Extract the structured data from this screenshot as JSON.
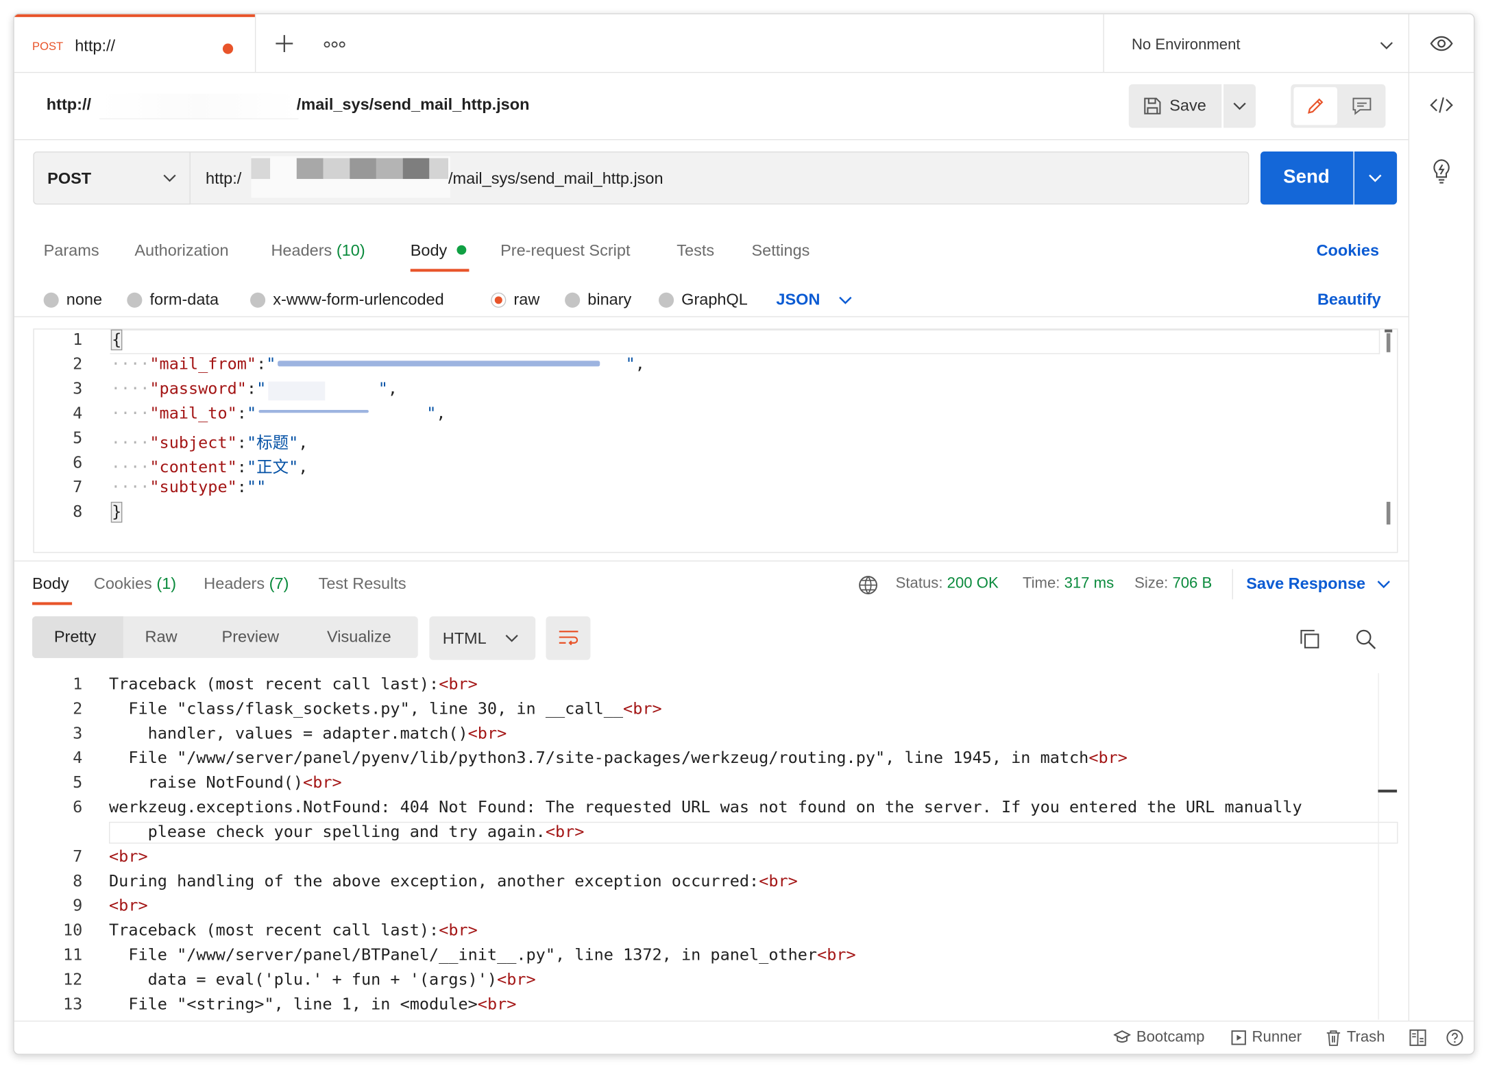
{
  "tabbar": {
    "tab_method": "POST",
    "tab_url": "http://",
    "add_icon": "plus-icon",
    "more_icon": "more-icon",
    "environment": "No Environment"
  },
  "request_header": {
    "url_title_prefix": "http://",
    "url_title_suffix": "/mail_sys/send_mail_http.json",
    "save_label": "Save"
  },
  "request": {
    "method": "POST",
    "url_prefix": "http:/",
    "url_suffix": "/mail_sys/send_mail_http.json",
    "send_label": "Send"
  },
  "request_tabs": {
    "params": "Params",
    "authorization": "Authorization",
    "headers": "Headers",
    "headers_count": "(10)",
    "body": "Body",
    "prerequest": "Pre-request Script",
    "tests": "Tests",
    "settings": "Settings",
    "cookies": "Cookies"
  },
  "body_types": {
    "none": "none",
    "form_data": "form-data",
    "urlencoded": "x-www-form-urlencoded",
    "raw": "raw",
    "binary": "binary",
    "graphql": "GraphQL",
    "format": "JSON",
    "beautify": "Beautify"
  },
  "request_body": {
    "line_numbers": [
      "1",
      "2",
      "3",
      "4",
      "5",
      "6",
      "7",
      "8"
    ],
    "open_brace": "{",
    "close_brace": "}",
    "k1": "\"mail_from\"",
    "k2": "\"password\"",
    "k3": "\"mail_to\"",
    "k4": "\"subject\"",
    "v4": "\"标题\"",
    "k5": "\"content\"",
    "v5": "\"正文\"",
    "k6": "\"subtype\"",
    "v6": "\"\""
  },
  "response_tabs": {
    "body": "Body",
    "cookies": "Cookies",
    "cookies_count": "(1)",
    "headers": "Headers",
    "headers_count": "(7)",
    "test_results": "Test Results",
    "status_label": "Status:",
    "status_value": "200 OK",
    "time_label": "Time:",
    "time_value": "317 ms",
    "size_label": "Size:",
    "size_value": "706 B",
    "save_response": "Save Response"
  },
  "response_view": {
    "pretty": "Pretty",
    "raw": "Raw",
    "preview": "Preview",
    "visualize": "Visualize",
    "format": "HTML"
  },
  "response_body": {
    "line_numbers": [
      "1",
      "2",
      "3",
      "4",
      "5",
      "6",
      "7",
      "8",
      "9",
      "10",
      "11",
      "12",
      "13"
    ],
    "l1": "Traceback (most recent call last):",
    "l2": "  File \"class/flask_sockets.py\", line 30, in __call__",
    "l3": "    handler, values = adapter.match()",
    "l4": "  File \"/www/server/panel/pyenv/lib/python3.7/site-packages/werkzeug/routing.py\", line 1945, in match",
    "l5": "    raise NotFound()",
    "l6a": "werkzeug.exceptions.NotFound: 404 Not Found: The requested URL was not found on the server. If you entered the URL manually",
    "l6b": "    please check your spelling and try again.",
    "l7": "",
    "l8": "During handling of the above exception, another exception occurred:",
    "l9": "",
    "l10": "Traceback (most recent call last):",
    "l11": "  File \"/www/server/panel/BTPanel/__init__.py\", line 1372, in panel_other",
    "l12": "    data = eval('plu.' + fun + '(args)')",
    "l13": "  File \"<string>\", line 1, in <module>",
    "br": "<br>"
  },
  "footer": {
    "bootcamp": "Bootcamp",
    "runner": "Runner",
    "trash": "Trash"
  },
  "colors": {
    "accent": "#e8542a",
    "send_blue": "#1467d8",
    "link_blue": "#0b5bd3",
    "ok_green": "#0a8a3c"
  }
}
